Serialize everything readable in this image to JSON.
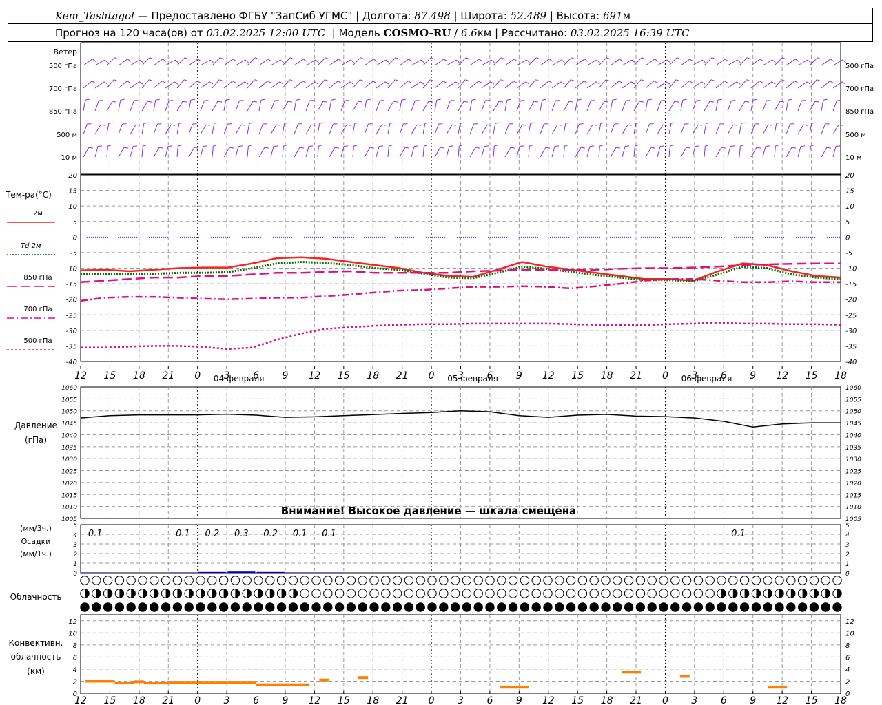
{
  "header": {
    "station": "Kem_Tashtagol",
    "provided": "— Предоставлено ФГБУ \"ЗапСиб УГМС\"",
    "lon_label": "Долгота:",
    "lon": "87.498",
    "lat_label": "Широта:",
    "lat": "52.489",
    "alt_label": "Высота:",
    "alt": "691",
    "alt_unit": "м",
    "forecast_label": "Прогноз на 120 часа(ов) от",
    "forecast_start": "03.02.2025 12:00 UTC",
    "model_label": "Модель",
    "model_name": "COSMO-RU",
    "model_res": "6.6",
    "model_res_unit": "км",
    "calc_label": "Рассчитано:",
    "calc_time": "03.02.2025 16:39 UTC"
  },
  "colors": {
    "wind": "#8a2be2",
    "t2m": "#ff2020",
    "td2m": "#007000",
    "t850": "#e0107a",
    "t700": "#e0107a",
    "t500": "#e0107a",
    "pressure": "#000000",
    "precip": "#0000cc",
    "conv": "#ff7f00",
    "grid": "#9a9a9a"
  },
  "chart_data": [
    {
      "panel": "wind",
      "type": "wind-barbs",
      "title": "Ветер",
      "levels": [
        "500 гПа",
        "700 гПа",
        "850 гПа",
        "500 м",
        "10 м"
      ]
    },
    {
      "panel": "temperature",
      "type": "line",
      "title": "Тем-ра(°C)",
      "ylim": [
        -40,
        20
      ],
      "yticks": [
        20,
        15,
        10,
        5,
        0,
        -5,
        -10,
        -15,
        -20,
        -25,
        -30,
        -35,
        -40
      ],
      "x_labels": [
        "12",
        "15",
        "18",
        "21",
        "0",
        "3",
        "6",
        "9",
        "12",
        "15",
        "18",
        "21",
        "0",
        "3",
        "6",
        "9",
        "12",
        "15",
        "18",
        "21",
        "0",
        "3",
        "6",
        "9",
        "12",
        "15",
        "18"
      ],
      "date_labels": [
        "04 февраля",
        "05 февраля",
        "06 февраля"
      ],
      "series": [
        {
          "name": "2м",
          "values": [
            -10.7,
            -10.5,
            -11,
            -10.5,
            -10,
            -9.8,
            -9.8,
            -8.5,
            -6.8,
            -6.5,
            -7,
            -8,
            -9,
            -10,
            -11.5,
            -12.5,
            -12.8,
            -10.5,
            -8,
            -9.5,
            -10.5,
            -11.5,
            -12.5,
            -13.5,
            -13.5,
            -14,
            -11,
            -8.5,
            -9,
            -11,
            -12.5,
            -13
          ]
        },
        {
          "name": "Td 2м",
          "values": [
            -12,
            -11.8,
            -12,
            -11.8,
            -11.5,
            -11.5,
            -11.3,
            -10,
            -8.5,
            -8,
            -8.3,
            -9,
            -10,
            -10.5,
            -11.8,
            -13,
            -13.2,
            -11.5,
            -9.5,
            -10.2,
            -11.2,
            -12.2,
            -13,
            -13.8,
            -13.8,
            -14.2,
            -12,
            -9.5,
            -10,
            -12,
            -13,
            -13.5
          ]
        },
        {
          "name": "850 гПа",
          "values": [
            -14.5,
            -14,
            -13.5,
            -13,
            -13,
            -12.5,
            -12.5,
            -12,
            -11.5,
            -11.5,
            -11.2,
            -11,
            -11.5,
            -11.5,
            -11.5,
            -11.5,
            -11,
            -10.8,
            -10.5,
            -10.5,
            -10.5,
            -10.5,
            -10.2,
            -10,
            -10,
            -9.8,
            -9.5,
            -9,
            -8.8,
            -8.6,
            -8.5,
            -8.5
          ]
        },
        {
          "name": "700 гПа",
          "values": [
            -20.5,
            -19.5,
            -19.2,
            -19.2,
            -19.5,
            -19.8,
            -20,
            -19.8,
            -19.5,
            -19.5,
            -19,
            -18.5,
            -17.8,
            -17.2,
            -17,
            -16.5,
            -16,
            -16,
            -15.8,
            -16,
            -16.5,
            -15.8,
            -15,
            -14,
            -13.5,
            -13.5,
            -14,
            -14.5,
            -14.5,
            -14.2,
            -14.5,
            -14.5
          ]
        },
        {
          "name": "500 гПа",
          "values": [
            -35.5,
            -35.5,
            -35.2,
            -35,
            -35,
            -35.3,
            -36,
            -35.5,
            -33,
            -31,
            -29.5,
            -29,
            -28.5,
            -28.2,
            -28,
            -28,
            -27.8,
            -27.8,
            -27.8,
            -27.8,
            -28,
            -28.2,
            -28.3,
            -28.3,
            -28,
            -27.8,
            -27.5,
            -27.8,
            -27.8,
            -28,
            -28,
            -28.2
          ]
        }
      ]
    },
    {
      "panel": "pressure",
      "type": "line",
      "title": "Давление",
      "unit": "(гПа)",
      "ylim": [
        1005,
        1060
      ],
      "yticks": [
        1060,
        1055,
        1050,
        1045,
        1040,
        1035,
        1030,
        1025,
        1020,
        1015,
        1010,
        1005
      ],
      "note": "Внимание! Высокое давление — шкала смещена",
      "series": [
        {
          "values": [
            1047,
            1048,
            1048.3,
            1048.3,
            1048.3,
            1048.6,
            1048.2,
            1047.3,
            1047.5,
            1048,
            1048.4,
            1048.9,
            1049.3,
            1050,
            1049.6,
            1048,
            1047.3,
            1048.2,
            1048.5,
            1047.8,
            1047.6,
            1047,
            1045.6,
            1043.2,
            1044.5,
            1045,
            1045
          ]
        }
      ]
    },
    {
      "panel": "precipitation",
      "type": "bar",
      "title": "Осадки",
      "unit_left_top": "(мм/3ч.)",
      "unit_left_bottom": "(мм/1ч.)",
      "ylim": [
        0,
        5
      ],
      "yticks": [
        5,
        4,
        3,
        2,
        1,
        0
      ],
      "labels": [
        {
          "hour": 3,
          "value": "0.1"
        },
        {
          "hour": 12,
          "value": "0.1"
        },
        {
          "hour": 15,
          "value": "0.2"
        },
        {
          "hour": 18,
          "value": "0.3"
        },
        {
          "hour": 21,
          "value": "0.2"
        },
        {
          "hour": 24,
          "value": "0.1"
        },
        {
          "hour": 27,
          "value": "0.1"
        },
        {
          "hour": 69,
          "value": "0.1"
        }
      ]
    },
    {
      "panel": "cloudiness",
      "type": "symbols",
      "title": "Облачность",
      "rows": 3,
      "upper": "OOOOOOOOOOOOOOOOOOOOOOOOOOOOOOOOOOOOOOOOOOOOOOOOOOOOOOOOOOOOOOOOOOOOOOOOOOOOOOOOOOOOOOOOOOOOOOOOOOOOOOOO",
      "middle": "HHHHHHHHHHHHHHHHHHHOOOOOOOOOOOOOOOOOOOOOOOOOOOOOOOOOOOOHHHHHHHHHHHHHHHHHHOOOOOOOOOOOOOOOOOOOOOOOOOOOOOOOO",
      "lower": "FFFFFFFFFFFFFFFFFFFFFFFFFFFFFFFFFFFFFFFFFFFFFFFFFFFFFFFFFFFFFFFFFFFFFFFFFFOOOOFFFFFFFFFFFFFFFFFFFFFFFFFFOOOFFFFF"
    },
    {
      "panel": "convective",
      "type": "bar",
      "title": "Конвективн. облачность",
      "unit": "(км)",
      "ylim": [
        0,
        13
      ],
      "yticks": [
        12,
        10,
        8,
        6,
        4,
        2,
        0
      ],
      "x_labels": [
        "12",
        "15",
        "18",
        "21",
        "0",
        "3",
        "6",
        "9",
        "12",
        "15",
        "18",
        "21",
        "0",
        "3",
        "6",
        "9",
        "12",
        "15",
        "18",
        "21",
        "0",
        "3",
        "6",
        "9",
        "12",
        "15",
        "18"
      ]
    }
  ]
}
